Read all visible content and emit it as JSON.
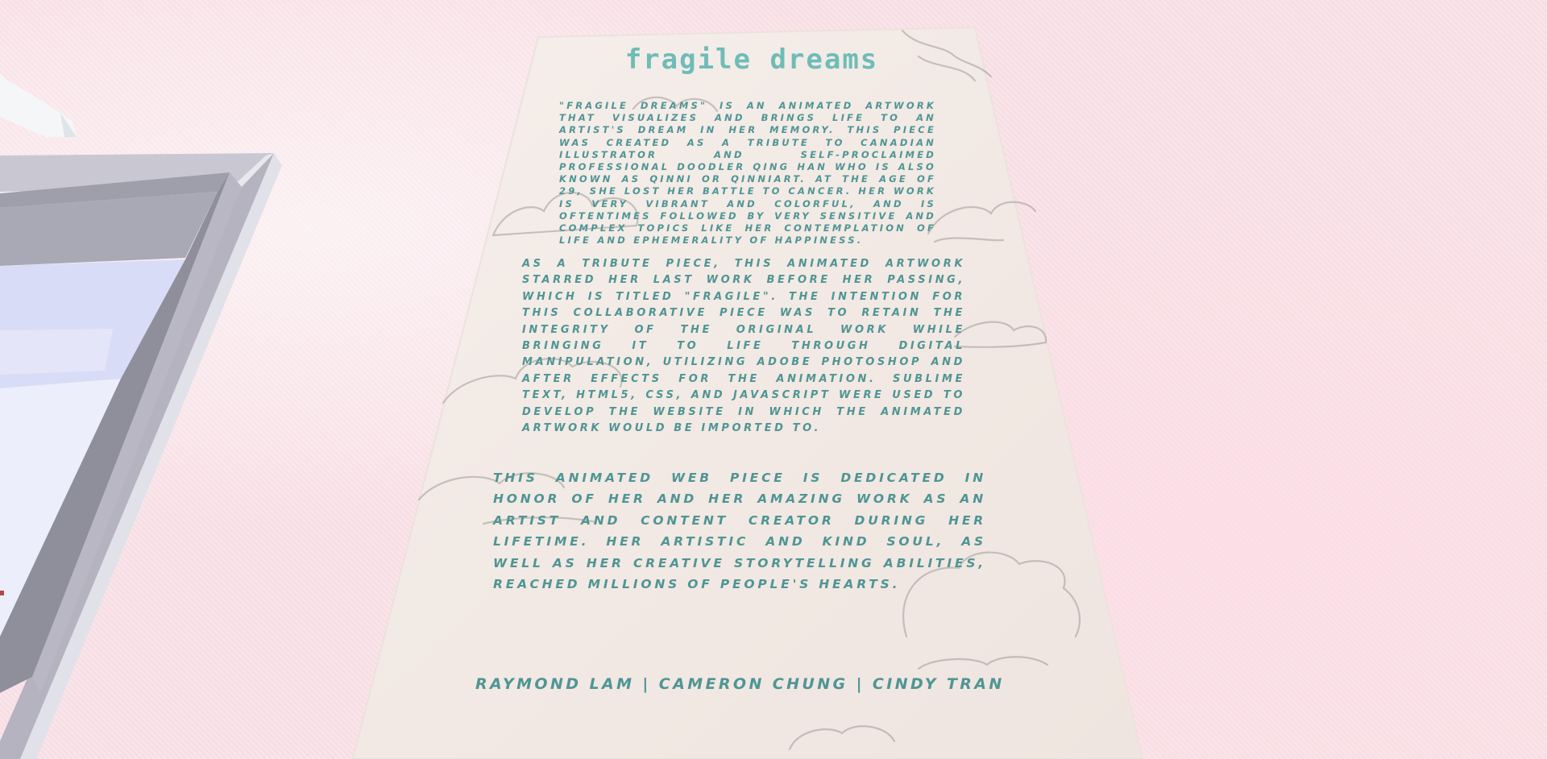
{
  "scene": {
    "background_color": "#f8e1e6",
    "panel_color": "#f3ebe6",
    "text_color": "#4f9594",
    "title_color": "#6fbcb7"
  },
  "panel": {
    "title": "fragile dreams",
    "paragraphs": [
      "\"FRAGILE DREAMS\" IS AN ANIMATED ARTWORK THAT VISUALIZES AND BRINGS LIFE TO AN ARTIST'S DREAM IN HER MEMORY. THIS PIECE WAS CREATED AS A TRIBUTE TO CANADIAN ILLUSTRATOR AND SELF-PROCLAIMED PROFESSIONAL DOODLER QING HAN WHO IS ALSO KNOWN AS QINNI OR QINNIART. AT THE AGE OF 29, SHE LOST HER BATTLE TO CANCER. HER WORK IS VERY VIBRANT AND COLORFUL, AND IS OFTENTIMES FOLLOWED BY VERY SENSITIVE AND COMPLEX TOPICS LIKE HER CONTEMPLATION OF LIFE AND EPHEMERALITY OF HAPPINESS.",
      "AS A TRIBUTE PIECE, THIS ANIMATED ARTWORK STARRED HER LAST WORK BEFORE HER PASSING, WHICH IS TITLED \"FRAGILE\". THE INTENTION FOR THIS COLLABORATIVE PIECE WAS TO RETAIN THE INTEGRITY OF THE ORIGINAL WORK WHILE BRINGING IT TO LIFE THROUGH DIGITAL MANIPULATION, UTILIZING ADOBE PHOTOSHOP AND AFTER EFFECTS FOR THE ANIMATION. SUBLIME TEXT, HTML5, CSS, AND JAVASCRIPT WERE USED TO DEVELOP THE WEBSITE IN WHICH THE ANIMATED ARTWORK WOULD BE IMPORTED TO.",
      "THIS ANIMATED WEB PIECE IS DEDICATED IN HONOR OF HER AND HER AMAZING WORK AS AN ARTIST AND CONTENT CREATOR DURING HER LIFETIME. HER ARTISTIC AND KIND SOUL, AS WELL AS HER CREATIVE STORYTELLING ABILITIES, REACHED MILLIONS OF PEOPLE'S HEARTS."
    ],
    "credits": "RAYMOND LAM | CAMERON CHUNG | CINDY TRAN"
  },
  "icons": {
    "door": "door-frame-icon",
    "ornament": "wall-ornament-icon",
    "clouds": "cloud-doodle-icon"
  }
}
